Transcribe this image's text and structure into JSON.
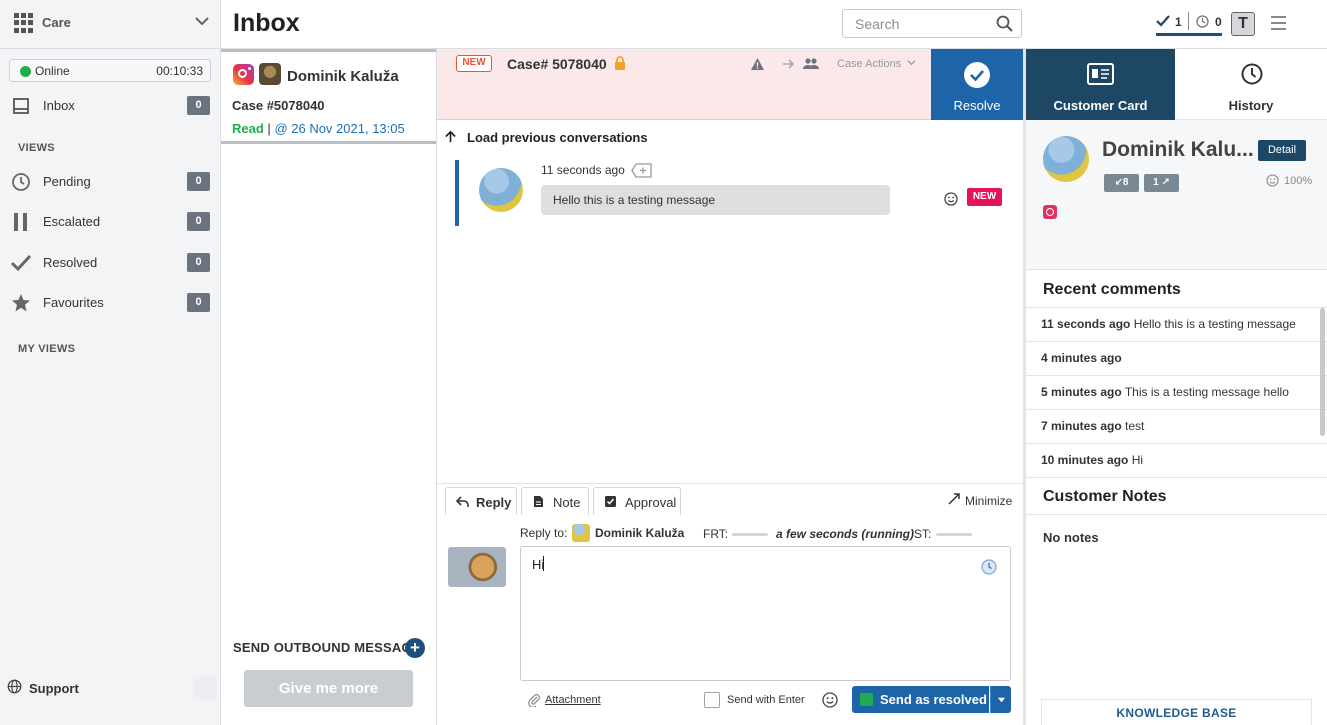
{
  "app": {
    "name": "Care",
    "page_title": "Inbox"
  },
  "status": {
    "label": "Online",
    "timer": "00:10:33",
    "color": "#1fae4b"
  },
  "nav": {
    "inbox": {
      "label": "Inbox",
      "count": "0"
    },
    "views_label": "VIEWS",
    "views": [
      {
        "label": "Pending",
        "count": "0",
        "icon": "clock-icon"
      },
      {
        "label": "Escalated",
        "count": "0",
        "icon": "pause-icon"
      },
      {
        "label": "Resolved",
        "count": "0",
        "icon": "check-icon"
      },
      {
        "label": "Favourites",
        "count": "0",
        "icon": "star-icon"
      }
    ],
    "my_views_label": "MY VIEWS",
    "support_label": "Support"
  },
  "header": {
    "search_placeholder": "Search",
    "resolved_count": "1",
    "pending_count": "0",
    "user_initial": "T"
  },
  "case_list": {
    "item": {
      "name": "Dominik Kaluža",
      "case_number": "Case #5078040",
      "status": "Read",
      "separator": "|",
      "timestamp": "@ 26 Nov 2021, 13:05"
    },
    "outbound_label": "SEND OUTBOUND MESSAGE",
    "give_more_label": "Give me more"
  },
  "conversation": {
    "badge": "NEW",
    "case_title": "Case# 5078040",
    "case_actions_label": "Case Actions",
    "resolve_label": "Resolve",
    "load_previous_label": "Load previous conversations",
    "messages": [
      {
        "time": "11 seconds ago",
        "text": "Hello this is a testing message",
        "badge": "NEW"
      }
    ]
  },
  "reply": {
    "tabs": [
      {
        "label": "Reply",
        "icon": "reply-icon"
      },
      {
        "label": "Note",
        "icon": "note-icon"
      },
      {
        "label": "Approval",
        "icon": "approval-icon"
      }
    ],
    "minimize_label": "Minimize",
    "reply_to_label": "Reply to:",
    "reply_to_name": "Dominik Kaluža",
    "frt_label": "FRT:",
    "frt_value": "a few seconds (running)",
    "st_label": "ST:",
    "composer_text": "Hi",
    "attachment_label": "Attachment",
    "send_with_enter_label": "Send with Enter",
    "send_label": "Send as resolved"
  },
  "customer_panel": {
    "tabs": {
      "customer_card": "Customer Card",
      "history": "History"
    },
    "name": "Dominik Kalu...",
    "detail_label": "Detail",
    "incoming_count": "8",
    "outgoing_count": "1",
    "satisfaction": "100%",
    "recent_comments_title": "Recent comments",
    "comments": [
      {
        "time": "11 seconds ago",
        "text": "Hello this is a testing message"
      },
      {
        "time": "4 minutes ago",
        "text": ""
      },
      {
        "time": "5 minutes ago",
        "text": "This is a testing message hello"
      },
      {
        "time": "7 minutes ago",
        "text": "test"
      },
      {
        "time": "10 minutes ago",
        "text": "Hi"
      }
    ],
    "notes_title": "Customer Notes",
    "notes_empty": "No notes",
    "knowledge_base_label": "KNOWLEDGE BASE"
  },
  "colors": {
    "primary": "#1d64a8",
    "dark": "#1e4766",
    "new": "#e6125c",
    "success": "#1fae4b"
  }
}
